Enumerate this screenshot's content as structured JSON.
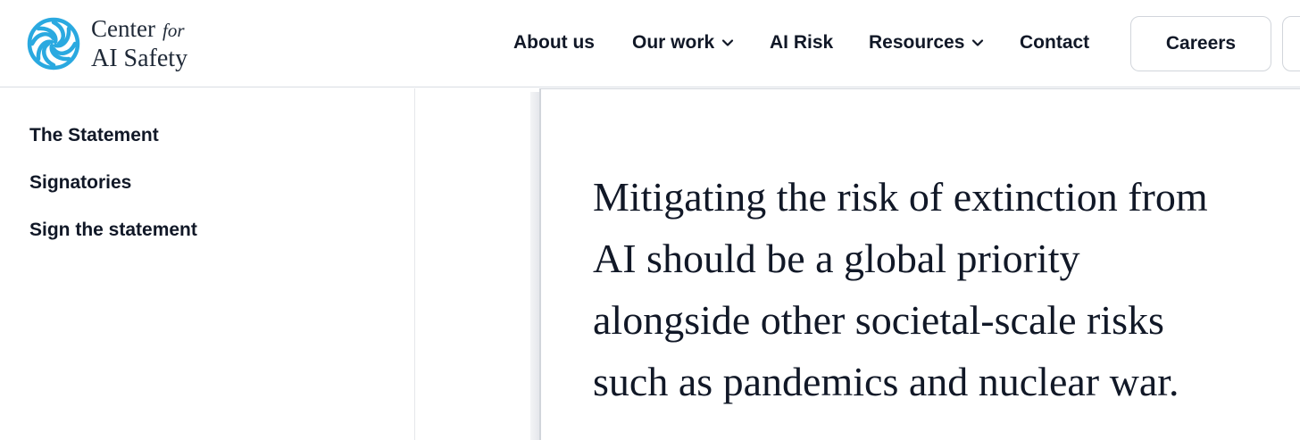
{
  "header": {
    "logo": {
      "line1": "Center",
      "line1_suffix": "for",
      "line2": "AI Safety",
      "icon": "cais-rings-logo",
      "icon_color": "#2aa9e0"
    },
    "nav": {
      "about": "About us",
      "our_work": "Our work",
      "ai_risk": "AI Risk",
      "resources": "Resources",
      "contact": "Contact"
    },
    "careers_label": "Careers"
  },
  "sidebar": {
    "items": [
      {
        "label": "The Statement"
      },
      {
        "label": "Signatories"
      },
      {
        "label": "Sign the statement"
      }
    ]
  },
  "main": {
    "statement_lines": [
      "Mitigating the risk of extinction from",
      "AI should be a global priority",
      "alongside other societal-scale risks",
      "such as pandemics and nuclear war."
    ]
  },
  "colors": {
    "text": "#111827",
    "border": "#d1d5db",
    "accent": "#2aa9e0"
  }
}
